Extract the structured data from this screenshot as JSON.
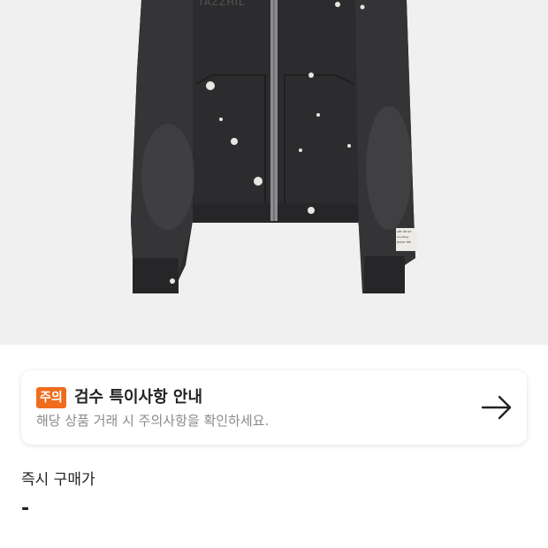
{
  "product": {
    "image_alt": "zip-up hoodie",
    "print_text": "TAZZHIL",
    "tag_lines": [
      "ART ON SO",
      "Courtesy",
      "JOSUE THE"
    ]
  },
  "notice": {
    "badge": "주의",
    "title": "검수 특이사항 안내",
    "description": "해당 상품 거래 시 주의사항을 확인하세요.",
    "arrow_icon": "arrow-right-icon"
  },
  "price": {
    "label": "즉시 구매가",
    "value": "-"
  },
  "colors": {
    "badge": "#ef6c1d",
    "image_bg": "#f0f0f0"
  }
}
